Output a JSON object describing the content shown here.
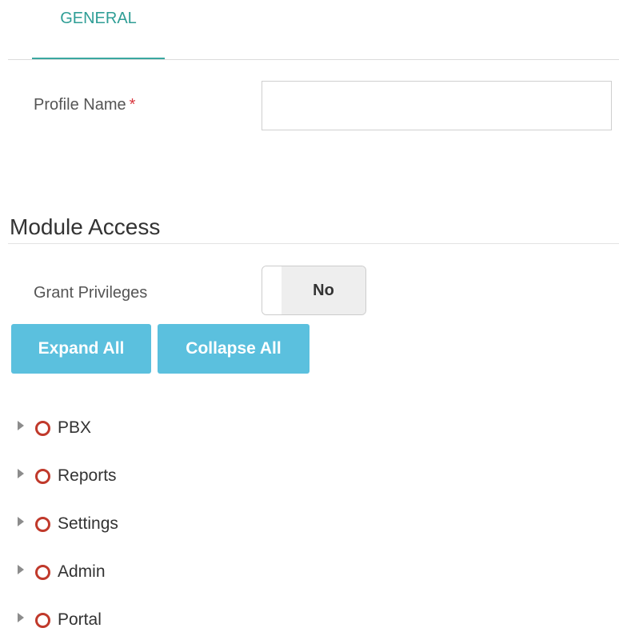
{
  "tabs": [
    {
      "label": "GENERAL",
      "active": true
    }
  ],
  "profile": {
    "label": "Profile Name",
    "required_marker": "*",
    "value": "",
    "placeholder": ""
  },
  "module_access": {
    "title": "Module Access",
    "grant_privileges": {
      "label": "Grant Privileges",
      "state": "No"
    },
    "expand_all_label": "Expand All",
    "collapse_all_label": "Collapse All",
    "tree": [
      {
        "label": "PBX"
      },
      {
        "label": "Reports"
      },
      {
        "label": "Settings"
      },
      {
        "label": "Admin"
      },
      {
        "label": "Portal"
      }
    ]
  },
  "colors": {
    "tab_accent": "#3aa7a0",
    "button_bg": "#5bc0de",
    "required": "#d9363e",
    "node_circle": "#c0392b"
  },
  "icons": {
    "tree_caret": "caret-right-icon",
    "tree_node": "circle-outline-icon"
  }
}
